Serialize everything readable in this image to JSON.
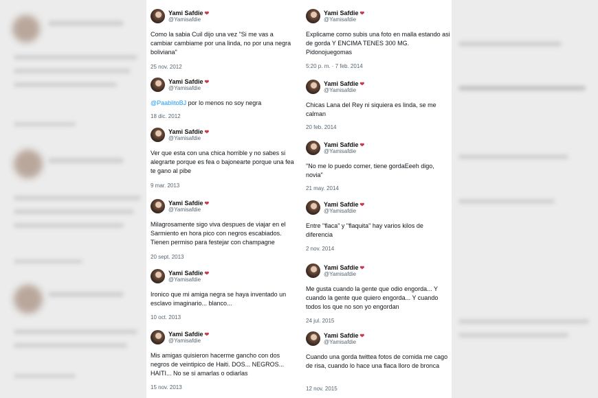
{
  "tweets_left": [
    {
      "name": "Yami Safdie",
      "handle": "@Yamisafdie",
      "text": "Como la sabia Cuil dijo una vez \"Si me vas a cambiar cambiame por una linda, no por una negra boliviana\"",
      "date": "25 nov. 2012"
    },
    {
      "name": "Yami Safdie",
      "handle": "@Yamisafdie",
      "mention": "@PaablitoBJ",
      "text": " por lo menos no soy negra",
      "date": "18 dic. 2012"
    },
    {
      "name": "Yami Safdie",
      "handle": "@Yamisafdie",
      "text": "Ver que esta con una chica horrible y no sabes si alegrarte porque es fea o bajonearte porque una fea te gano al pibe",
      "date": "9 mar. 2013"
    },
    {
      "name": "Yami Safdie",
      "handle": "@Yamisafdie",
      "text": "Milagrosamente sigo viva despues de viajar en el Sarmiento en hora pico con negros escabiados. Tienen permiso para festejar con champagne",
      "date": "20 sept. 2013"
    },
    {
      "name": "Yami Safdie",
      "handle": "@Yamisafdie",
      "text": "Ironico que mi amiga negra se haya inventado un esclavo imaginario... blanco...",
      "date": "10 oct. 2013"
    },
    {
      "name": "Yami Safdie",
      "handle": "@Yamisafdie",
      "text": "Mis amigas quisieron hacerme gancho con dos negros de veintipico de Haiti. DOS... NEGROS... HAITI... No se si amarlas o odiarlas",
      "date": "15 nov. 2013"
    }
  ],
  "tweets_right": [
    {
      "name": "Yami Safdie",
      "handle": "@Yamisafdie",
      "text": "Explicame como subis una foto en malla estando asi de gorda Y ENCIMA TENES 300 MG. Pidonojuegomas",
      "date": "5:20 p. m. · 7 feb. 2014"
    },
    {
      "name": "Yami Safdie",
      "handle": "@Yamisafdie",
      "text": "Chicas Lana del Rey ni siquiera es linda, se me calman",
      "date": "20 feb. 2014"
    },
    {
      "name": "Yami Safdie",
      "handle": "@Yamisafdie",
      "text": "\"No me lo puedo comer, tiene gordaEeeh digo, novia\"",
      "date": "21 may. 2014"
    },
    {
      "name": "Yami Safdie",
      "handle": "@Yamisafdie",
      "text": "Entre \"flaca\" y \"flaquita\" hay varios kilos de diferencia",
      "date": "2 nov. 2014"
    },
    {
      "name": "Yami Safdie",
      "handle": "@Yamisafdie",
      "text": "Me gusta cuando la gente que odio engorda... Y cuando la gente que quiero engorda... Y cuando todos los que no son yo engordan",
      "date": "24 jul. 2015"
    },
    {
      "name": "Yami Safdie",
      "handle": "@Yamisafdie",
      "text": "Cuando una gorda twittea fotos de comida me cago de risa, cuando lo hace una flaca lloro de bronca",
      "date": "12 nov. 2015"
    }
  ],
  "colors": {
    "name_heart": "#c43a4e",
    "mention": "#1d9bf0",
    "meta": "#536471",
    "text": "#0f1419"
  }
}
